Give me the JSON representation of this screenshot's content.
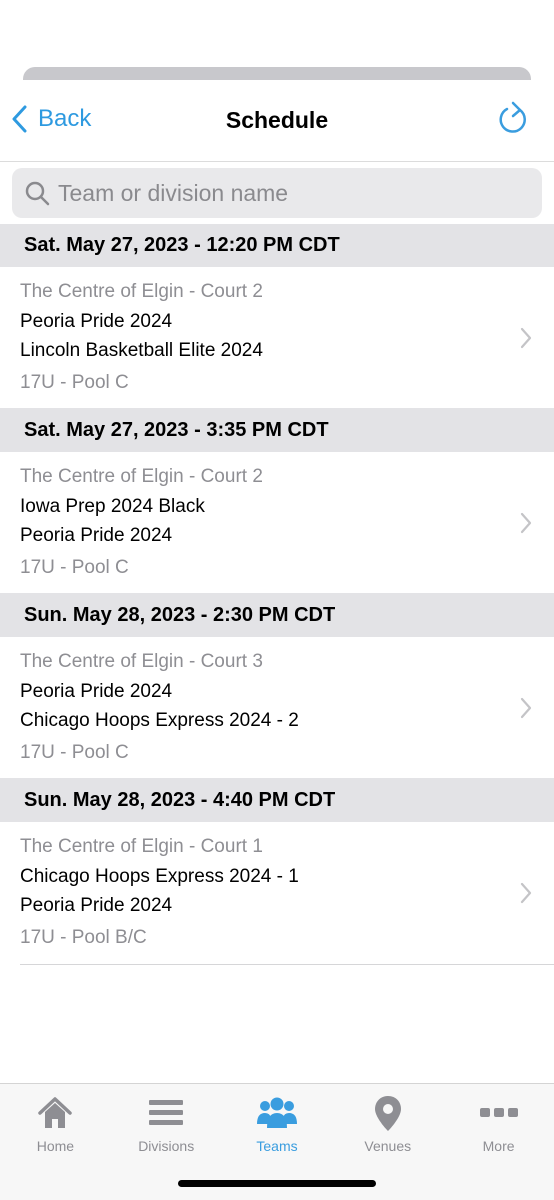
{
  "navbar": {
    "back_label": "Back",
    "title": "Schedule"
  },
  "search": {
    "placeholder": "Team or division name",
    "value": ""
  },
  "schedule": [
    {
      "header": "Sat. May 27, 2023 - 12:20 PM CDT",
      "venue": "The Centre of Elgin - Court 2",
      "team1": "Peoria Pride 2024",
      "team2": "Lincoln Basketball Elite 2024",
      "division": "17U - Pool C"
    },
    {
      "header": "Sat. May 27, 2023 - 3:35 PM CDT",
      "venue": "The Centre of Elgin - Court 2",
      "team1": "Iowa Prep 2024 Black",
      "team2": "Peoria Pride 2024",
      "division": "17U - Pool C"
    },
    {
      "header": "Sun. May 28, 2023 - 2:30 PM CDT",
      "venue": "The Centre of Elgin - Court 3",
      "team1": "Peoria Pride 2024",
      "team2": "Chicago Hoops Express 2024 - 2",
      "division": "17U - Pool C"
    },
    {
      "header": "Sun. May 28, 2023 - 4:40 PM CDT",
      "venue": "The Centre of Elgin - Court 1",
      "team1": "Chicago Hoops Express 2024 - 1",
      "team2": "Peoria Pride 2024",
      "division": "17U - Pool B/C"
    }
  ],
  "tabbar": {
    "items": [
      {
        "label": "Home",
        "icon": "home-icon",
        "active": false
      },
      {
        "label": "Divisions",
        "icon": "list-icon",
        "active": false
      },
      {
        "label": "Teams",
        "icon": "people-icon",
        "active": true
      },
      {
        "label": "Venues",
        "icon": "map-pin-icon",
        "active": false
      },
      {
        "label": "More",
        "icon": "more-icon",
        "active": false
      }
    ]
  },
  "colors": {
    "accent": "#3a9ddf",
    "section_header_bg": "#e3e3e6",
    "secondary_text": "#8e8e93",
    "tab_inactive": "#8e8e93"
  }
}
